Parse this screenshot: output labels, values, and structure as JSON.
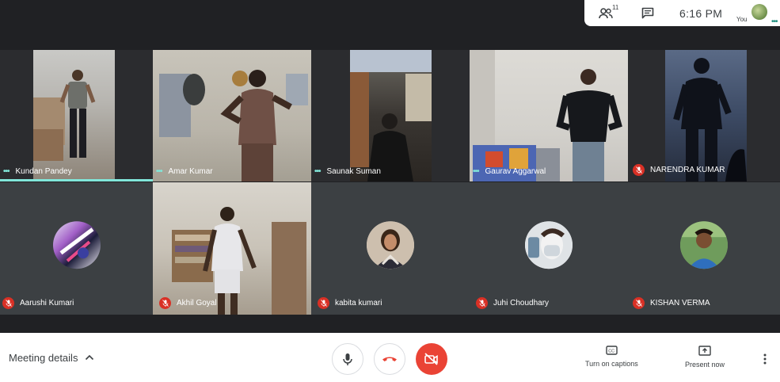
{
  "topbar": {
    "people_count": "11",
    "time": "6:16 PM",
    "you_label": "You"
  },
  "participants": [
    {
      "name": "Kundan Pandey",
      "status": "speaking"
    },
    {
      "name": "Amar Kumar",
      "status": "speaking"
    },
    {
      "name": "Saunak Suman",
      "status": "speaking"
    },
    {
      "name": "Gaurav Aggarwal",
      "status": "speaking"
    },
    {
      "name": "NARENDRA KUMAR",
      "status": "muted"
    },
    {
      "name": "Aarushi Kumari",
      "status": "muted"
    },
    {
      "name": "Akhil Goyal",
      "status": "muted"
    },
    {
      "name": "kabita kumari",
      "status": "muted"
    },
    {
      "name": "Juhi Choudhary",
      "status": "muted"
    },
    {
      "name": "KISHAN VERMA",
      "status": "muted"
    }
  ],
  "bottombar": {
    "meeting_details": "Meeting details",
    "captions_label": "Turn on captions",
    "present_label": "Present now"
  },
  "icons": {
    "people": "people-icon",
    "chat": "chat-icon",
    "mic": "mic-icon",
    "hangup": "call-end-icon",
    "camera_off": "videocam-off-icon",
    "captions": "closed-caption-icon",
    "present": "present-screen-icon",
    "more": "more-vert-icon"
  },
  "colors": {
    "accent_teal": "#81e6d9",
    "danger_red": "#ea4335",
    "tile_bg": "#3c4043",
    "page_bg": "#202124"
  }
}
